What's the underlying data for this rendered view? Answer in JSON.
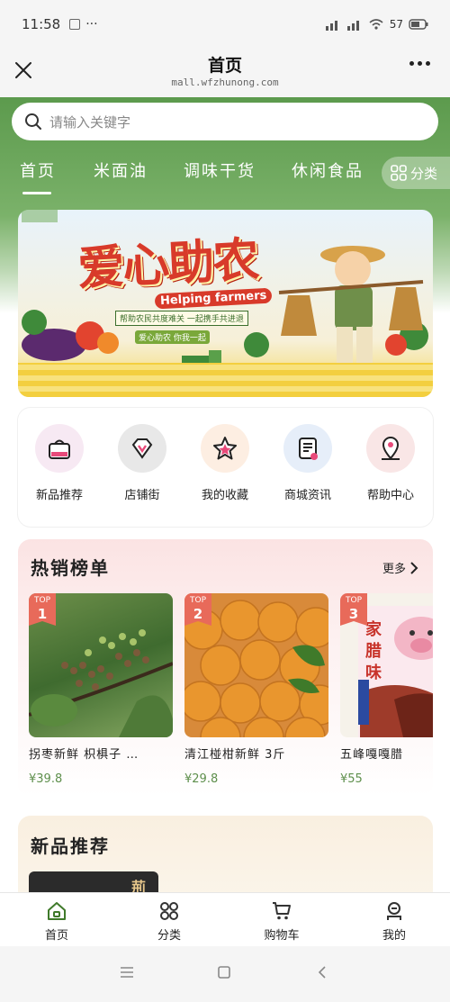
{
  "status_bar": {
    "time": "11:58",
    "extra": "···",
    "battery": "57"
  },
  "title_bar": {
    "title": "首页",
    "url": "mall.wfzhunong.com"
  },
  "search": {
    "placeholder": "请输入关键字"
  },
  "category_tabs": [
    {
      "label": "首页",
      "active": true
    },
    {
      "label": "米面油",
      "active": false
    },
    {
      "label": "调味干货",
      "active": false
    },
    {
      "label": "休闲食品",
      "active": false
    }
  ],
  "category_button": {
    "label": "分类",
    "icon": "grid-icon"
  },
  "banner": {
    "title": "爱心助农",
    "subtitle": "Helping farmers",
    "tagline": "帮助农民共度难关 一起携手共进退",
    "tagline2": "爱心助农  你我一起"
  },
  "quick_menu": [
    {
      "label": "新品推荐",
      "icon": "bag-icon",
      "bg": "#f7e9f3"
    },
    {
      "label": "店铺街",
      "icon": "diamond-icon",
      "bg": "#e8e8e8"
    },
    {
      "label": "我的收藏",
      "icon": "star-icon",
      "bg": "#fdeee2"
    },
    {
      "label": "商城资讯",
      "icon": "document-icon",
      "bg": "#e6eef9"
    },
    {
      "label": "帮助中心",
      "icon": "location-icon",
      "bg": "#f9e6e6"
    }
  ],
  "hot_list": {
    "title": "热销榜单",
    "more_label": "更多",
    "products": [
      {
        "rank_label": "TOP",
        "rank": "1",
        "name": "拐枣新鲜 枳椇子 …",
        "price": "¥39.8"
      },
      {
        "rank_label": "TOP",
        "rank": "2",
        "name": "清江椪柑新鲜 3斤",
        "price": "¥29.8"
      },
      {
        "rank_label": "TOP",
        "rank": "3",
        "name": "五峰嘎嘎腊",
        "price": "¥55"
      }
    ]
  },
  "new_products": {
    "title": "新品推荐",
    "thumb_text": "荊"
  },
  "tab_bar": [
    {
      "label": "首页",
      "icon": "home-icon",
      "active": true
    },
    {
      "label": "分类",
      "icon": "grid-icon",
      "active": false
    },
    {
      "label": "购物车",
      "icon": "cart-icon",
      "active": false
    },
    {
      "label": "我的",
      "icon": "user-icon",
      "active": false
    }
  ],
  "colors": {
    "brand_green": "#5c9a4d",
    "price_green": "#5e8f4c",
    "badge_red": "#e86a5a"
  }
}
